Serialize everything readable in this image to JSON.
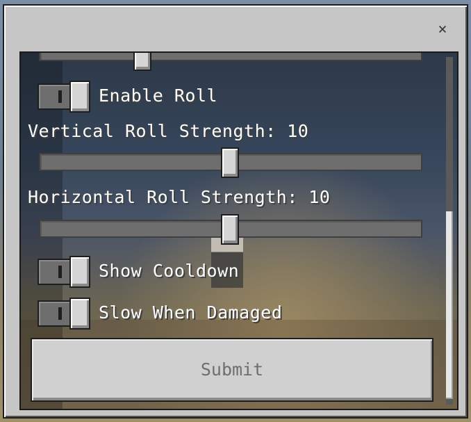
{
  "dialog": {
    "close_icon": "×"
  },
  "form": {
    "top_slider": {
      "value_fraction": 0.26
    },
    "enable_roll": {
      "label": "Enable Roll",
      "on": true
    },
    "vertical_roll": {
      "label": "Vertical Roll Strength: 10",
      "value_fraction": 0.5
    },
    "horizontal_roll": {
      "label": "Horizontal Roll Strength: 10",
      "value_fraction": 0.5
    },
    "show_cooldown": {
      "label": "Show Cooldown",
      "on": true
    },
    "slow_when_damaged": {
      "label": "Slow When Damaged",
      "on": true
    },
    "submit_label": "Submit"
  },
  "scroll": {
    "position_fraction": 1.0
  }
}
